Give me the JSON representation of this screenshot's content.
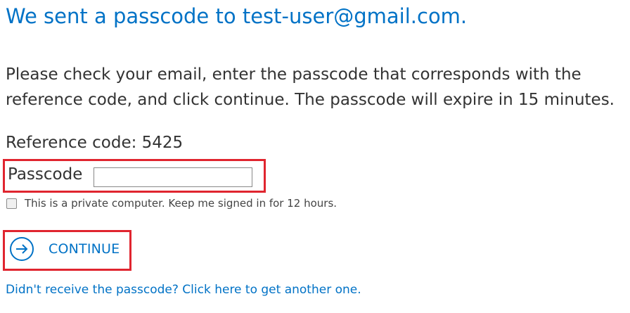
{
  "heading": "We sent a passcode to test-user@gmail.com.",
  "instructions": "Please check your email, enter the passcode that corresponds with the reference code, and click continue. The passcode will expire in 15 minutes.",
  "reference_code_text": "Reference code: 5425",
  "passcode": {
    "label": "Passcode",
    "value": ""
  },
  "remember_me": {
    "label": "This is a private computer. Keep me signed in for 12 hours.",
    "checked": false
  },
  "continue_button": {
    "label": "CONTINUE",
    "icon": "arrow-right-circle-icon"
  },
  "resend_link": "Didn't receive the passcode? Click here to get another one.",
  "colors": {
    "accent": "#0072c6",
    "highlight_border": "#e0252f",
    "text": "#333333"
  }
}
